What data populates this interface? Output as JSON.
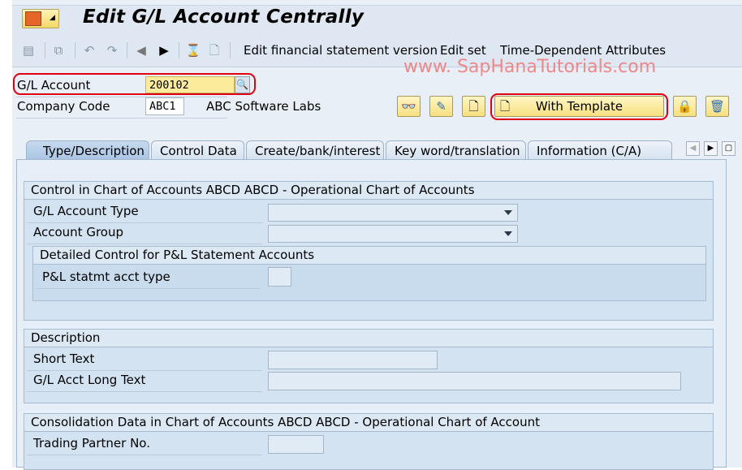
{
  "title": "Edit G/L Account Centrally",
  "toolbar": {
    "items": [
      "Edit financial statement version",
      "Edit set",
      "Time-Dependent Attributes"
    ]
  },
  "watermark": "www. SapHanaTutorials.com",
  "header": {
    "gl_account_label": "G/L Account",
    "gl_account_value": "200102",
    "company_code_label": "Company Code",
    "company_code_value": "ABC1",
    "company_name": "ABC Software Labs",
    "with_template_label": "With Template"
  },
  "tabs": [
    {
      "label": "Type/Description",
      "active": true
    },
    {
      "label": "Control Data"
    },
    {
      "label": "Create/bank/interest"
    },
    {
      "label": "Key word/translation"
    },
    {
      "label": "Information (C/A)"
    }
  ],
  "groups": {
    "control": {
      "title": "Control in Chart of Accounts ABCD ABCD - Operational Chart of Accounts",
      "gl_type": "G/L Account Type",
      "acct_group": "Account Group",
      "pl": {
        "title": "Detailed Control for P&L Statement Accounts",
        "pl_type": "P&L statmt acct type"
      }
    },
    "description": {
      "title": "Description",
      "short": "Short Text",
      "long": "G/L Acct Long Text"
    },
    "consolidation": {
      "title": "Consolidation Data in Chart of Accounts ABCD ABCD - Operational Chart of Account",
      "partner": "Trading Partner No."
    }
  },
  "colors": {
    "highlight": "#e0000f",
    "button": "#f7df80",
    "group": "#d3e3f2"
  }
}
